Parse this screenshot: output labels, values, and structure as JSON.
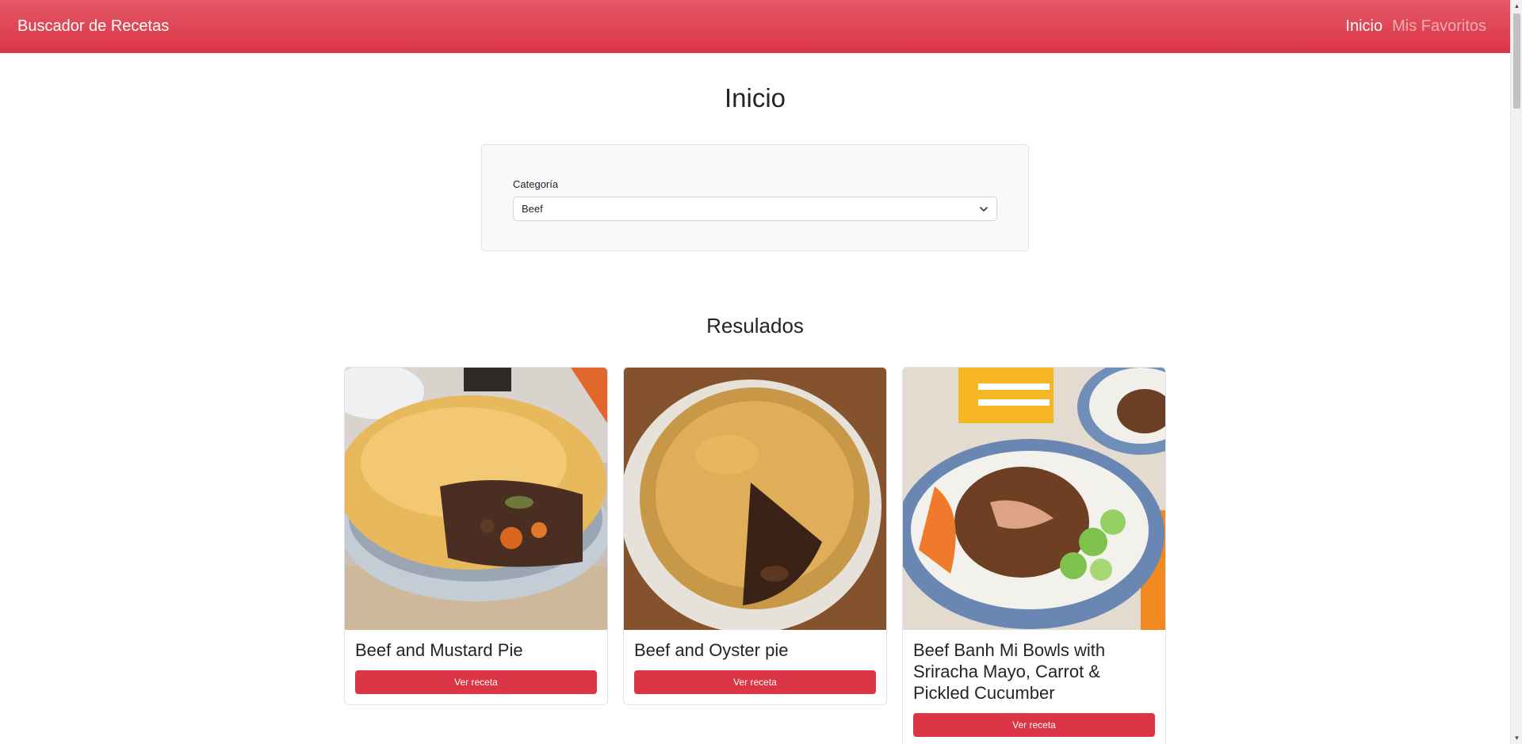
{
  "navbar": {
    "brand": "Buscador de Recetas",
    "links": [
      {
        "label": "Inicio",
        "active": true
      },
      {
        "label": "Mis Favoritos",
        "active": false
      }
    ]
  },
  "page": {
    "title": "Inicio"
  },
  "filter": {
    "label": "Categoría",
    "selected": "Beef"
  },
  "results": {
    "title": "Resulados",
    "cards": [
      {
        "title": "Beef and Mustard Pie",
        "button": "Ver receta"
      },
      {
        "title": "Beef and Oyster pie",
        "button": "Ver receta"
      },
      {
        "title": "Beef Banh Mi Bowls with Sriracha Mayo, Carrot & Pickled Cucumber",
        "button": "Ver receta"
      }
    ]
  },
  "colors": {
    "primary": "#dc3545",
    "navbar_top": "#e35867",
    "card_border": "#dee2e6"
  }
}
